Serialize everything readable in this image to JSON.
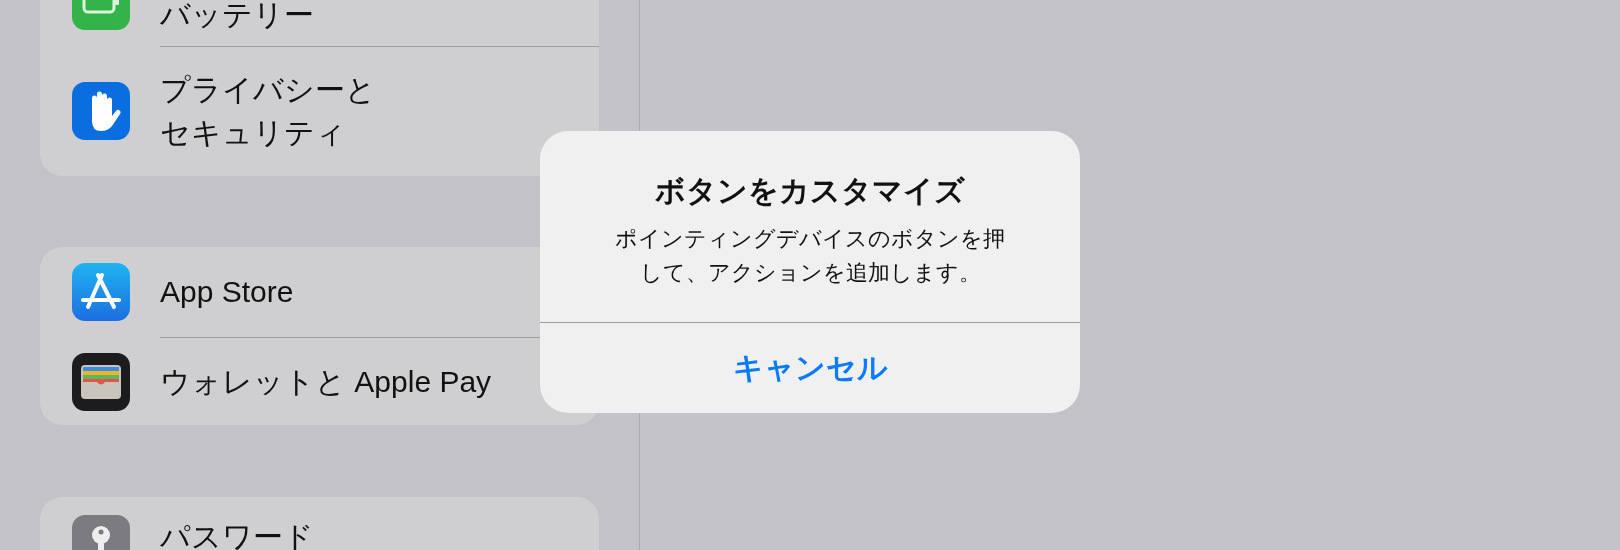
{
  "sidebar": {
    "groups": [
      {
        "items": [
          {
            "label": "バッテリー",
            "kind": "battery"
          },
          {
            "label": "プライバシーとセキュリティ",
            "kind": "privacy"
          }
        ]
      },
      {
        "items": [
          {
            "label": "App Store",
            "kind": "appstore"
          },
          {
            "label": "ウォレットと Apple Pay",
            "kind": "wallet"
          }
        ]
      },
      {
        "items": [
          {
            "label": "パスワード",
            "kind": "password"
          }
        ]
      }
    ]
  },
  "alert": {
    "title": "ボタンをカスタマイズ",
    "message": "ポインティングデバイスのボタンを押して、アクションを追加します。",
    "buttons": [
      {
        "label": "キャンセル"
      }
    ]
  }
}
